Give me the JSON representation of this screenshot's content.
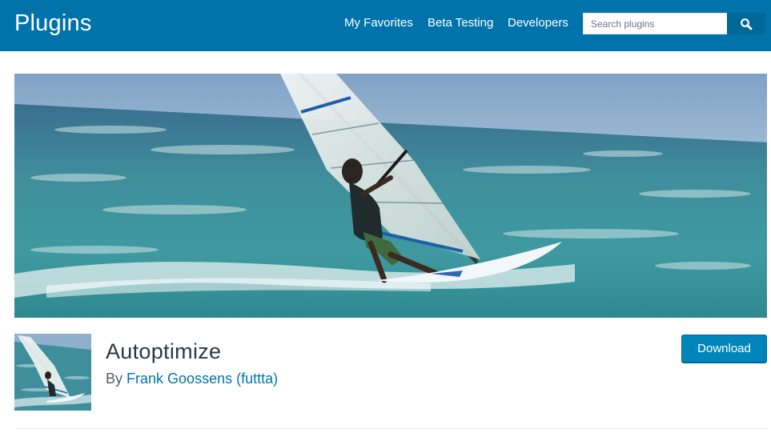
{
  "header": {
    "site_title": "Plugins",
    "nav": [
      {
        "label": "My Favorites"
      },
      {
        "label": "Beta Testing"
      },
      {
        "label": "Developers"
      }
    ],
    "search": {
      "placeholder": "Search plugins",
      "button_icon": "search-icon"
    },
    "background_color": "#0073aa"
  },
  "banner": {
    "image": "windsurfer-on-ocean-waves"
  },
  "plugin": {
    "name": "Autoptimize",
    "by_prefix": "By",
    "author": "Frank Goossens (futtta)",
    "download_label": "Download",
    "icon_image": "windsurfer-thumbnail"
  },
  "colors": {
    "brand_blue": "#0073aa",
    "button_blue": "#0085ba",
    "link_blue": "#0073aa",
    "title_text": "#32373c"
  }
}
